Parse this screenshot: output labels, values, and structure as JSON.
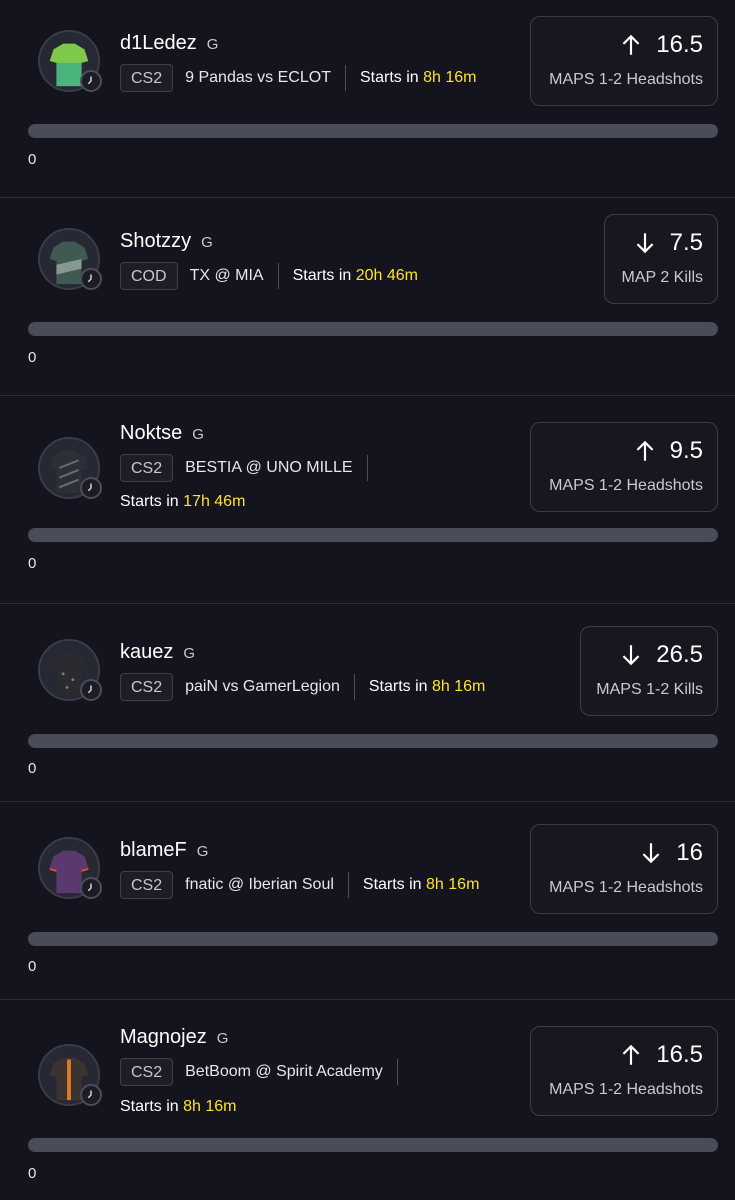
{
  "picks": [
    {
      "player": "d1Ledez",
      "position": "G",
      "game": "CS2",
      "matchup": "9 Pandas vs ECLOT",
      "starts_label": "Starts in",
      "starts_time": "8h 16m",
      "direction": "up",
      "line": "16.5",
      "stat": "MAPS 1-2 Headshots",
      "count": "0",
      "jersey": "#7ec94a"
    },
    {
      "player": "Shotzzy",
      "position": "G",
      "game": "COD",
      "matchup": "TX @ MIA",
      "starts_label": "Starts in",
      "starts_time": "20h 46m",
      "direction": "down",
      "line": "7.5",
      "stat": "MAP 2 Kills",
      "count": "0",
      "jersey": "#3e5a52"
    },
    {
      "player": "Noktse",
      "position": "G",
      "game": "CS2",
      "matchup": "BESTIA @ UNO MILLE",
      "starts_label": "Starts in",
      "starts_time": "17h 46m",
      "direction": "up",
      "line": "9.5",
      "stat": "MAPS 1-2 Headshots",
      "count": "0",
      "jersey": "#2d2f36"
    },
    {
      "player": "kauez",
      "position": "G",
      "game": "CS2",
      "matchup": "paiN vs GamerLegion",
      "starts_label": "Starts in",
      "starts_time": "8h 16m",
      "direction": "down",
      "line": "26.5",
      "stat": "MAPS 1-2 Kills",
      "count": "0",
      "jersey": "#2a2a30"
    },
    {
      "player": "blameF",
      "position": "G",
      "game": "CS2",
      "matchup": "fnatic @ Iberian Soul",
      "starts_label": "Starts in",
      "starts_time": "8h 16m",
      "direction": "down",
      "line": "16",
      "stat": "MAPS 1-2 Headshots",
      "count": "0",
      "jersey": "#5a3a6e"
    },
    {
      "player": "Magnojez",
      "position": "G",
      "game": "CS2",
      "matchup": "BetBoom @ Spirit Academy",
      "starts_label": "Starts in",
      "starts_time": "8h 16m",
      "direction": "up",
      "line": "16.5",
      "stat": "MAPS 1-2 Headshots",
      "count": "0",
      "jersey": "#3a3330"
    }
  ]
}
